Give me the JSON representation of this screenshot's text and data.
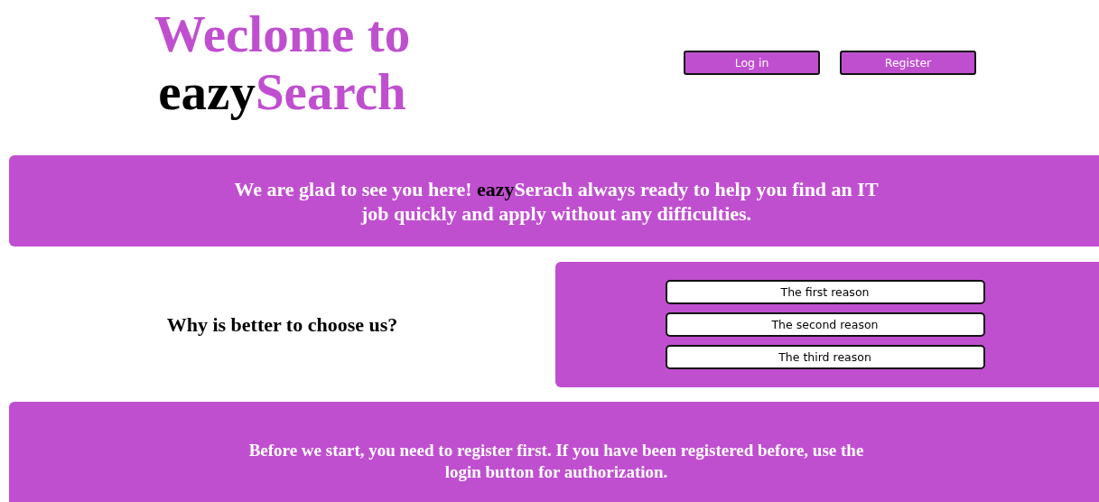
{
  "header": {
    "title_line_1": "Weclome to",
    "brand_dark": "eazy",
    "brand_accent": "Search",
    "buttons": [
      {
        "label": "Log in"
      },
      {
        "label": "Register"
      }
    ]
  },
  "welcome": {
    "lead": "We are glad to see you here! ",
    "brand": "eazy",
    "rest": "Serach always ready to help you find an IT job quickly and apply without any difficulties."
  },
  "reasons": {
    "question": "Why is better to choose us?",
    "items": [
      {
        "label": "The first reason"
      },
      {
        "label": "The second reason"
      },
      {
        "label": "The third reason"
      }
    ]
  },
  "notice": {
    "text": "Before we start, you need to register first. If you have been registered before, use the login button for authorization."
  }
}
